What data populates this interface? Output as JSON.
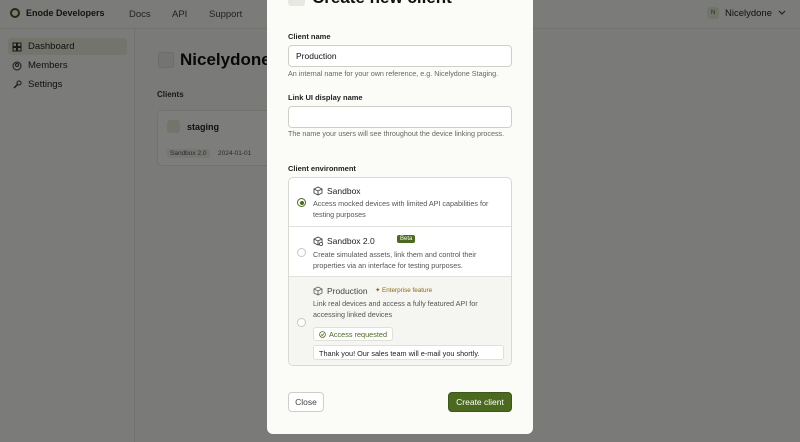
{
  "app": {
    "brand": "Enode Developers",
    "nav": [
      "Docs",
      "API",
      "Support"
    ],
    "user": {
      "initial": "N",
      "name": "Nicelydone"
    }
  },
  "sidebar": {
    "items": [
      {
        "label": "Dashboard",
        "icon": "grid-icon",
        "active": true
      },
      {
        "label": "Members",
        "icon": "user-circle-icon",
        "active": false
      },
      {
        "label": "Settings",
        "icon": "wrench-icon",
        "active": false
      }
    ]
  },
  "page": {
    "title": "Nicelydone",
    "clients_label": "Clients",
    "client_card": {
      "name": "staging",
      "env_tag": "Sandbox 2.0",
      "date": "2024-01-01"
    }
  },
  "modal": {
    "title": "Create new client",
    "client_name": {
      "label": "Client name",
      "value": "Production",
      "help": "An internal name for your own reference, e.g. Nicelydone Staging."
    },
    "link_ui": {
      "label": "Link UI display name",
      "value": "",
      "help": "The name your users will see throughout the device linking process."
    },
    "environment": {
      "label": "Client environment",
      "options": [
        {
          "title": "Sandbox",
          "desc": "Access mocked devices with limited API capabilities for testing purposes",
          "selected": true,
          "icon": "cube-icon"
        },
        {
          "title": "Sandbox 2.0",
          "badge": "Beta",
          "desc": "Create simulated assets, link them and control their properties via an interface for testing purposes.",
          "selected": false,
          "icon": "cube-gear-icon"
        },
        {
          "title": "Production",
          "tag": "Enterprise feature",
          "desc": "Link real devices and access a fully featured API for accessing linked devices",
          "selected": false,
          "icon": "cube-icon",
          "status": "Access requested",
          "note": "Thank you! Our sales team will e-mail you shortly."
        }
      ]
    },
    "buttons": {
      "close": "Close",
      "create": "Create client"
    }
  },
  "colors": {
    "accent": "#4b6a1f",
    "enterprise": "#8a6d12",
    "overlay": "rgba(0,0,0,0.5)"
  }
}
